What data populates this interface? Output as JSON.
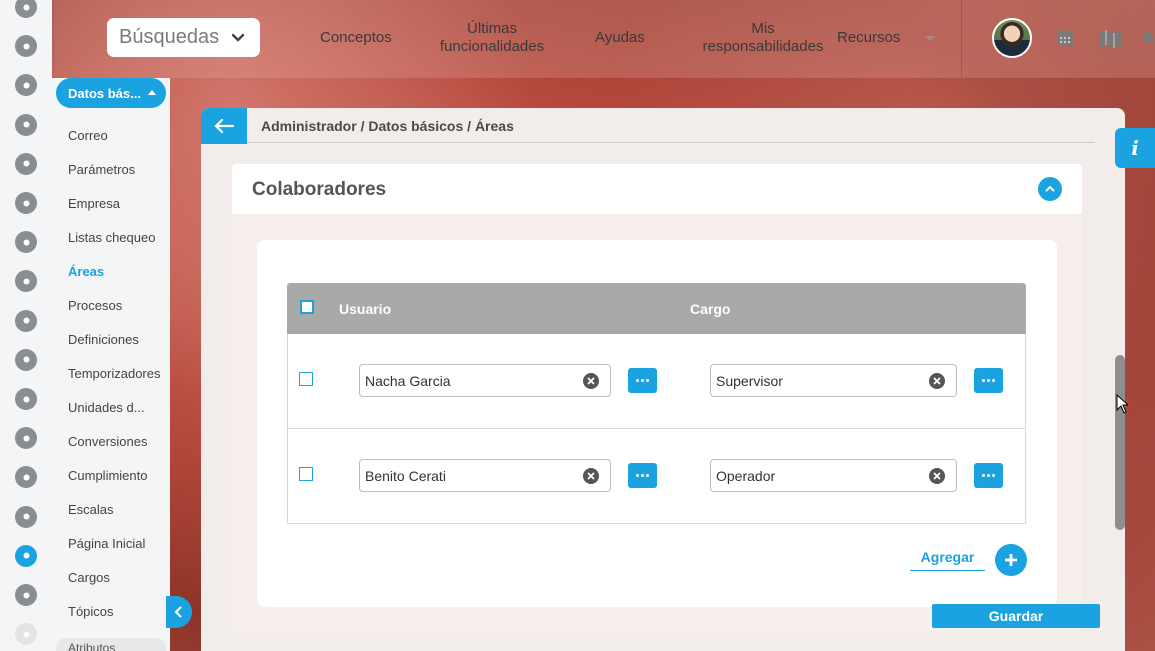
{
  "search": {
    "label": "Búsquedas"
  },
  "nav": {
    "items": [
      {
        "label": "Conceptos"
      },
      {
        "label": "Últimas funcionalidades"
      },
      {
        "label": "Ayudas"
      },
      {
        "label": "Mis responsabilidades"
      },
      {
        "label": "Recursos"
      }
    ]
  },
  "sidebar": {
    "section_label": "Datos bás...",
    "items": [
      {
        "label": "Correo"
      },
      {
        "label": "Parámetros"
      },
      {
        "label": "Empresa"
      },
      {
        "label": "Listas chequeo"
      },
      {
        "label": "Áreas"
      },
      {
        "label": "Procesos"
      },
      {
        "label": "Definiciones"
      },
      {
        "label": "Temporizadores"
      },
      {
        "label": "Unidades d..."
      },
      {
        "label": "Conversiones"
      },
      {
        "label": "Cumplimiento"
      },
      {
        "label": "Escalas"
      },
      {
        "label": "Página Inicial"
      },
      {
        "label": "Cargos"
      },
      {
        "label": "Tópicos"
      }
    ],
    "bottom_label": "Atributos",
    "active": "Áreas",
    "icons": [
      "chart-icon",
      "menu-icon",
      "pie-chart-icon",
      "document-icon",
      "cycle-icon",
      "check-icon",
      "warning-icon",
      "settings-group-icon",
      "monitor-icon",
      "clock-icon",
      "cloud-icon",
      "calendar-icon",
      "network-icon",
      "list-icon",
      "gear-icon",
      "alert-icon",
      "blank-icon"
    ]
  },
  "breadcrumb": "Administrador / Datos básicos / Áreas",
  "section": {
    "title": "Colaboradores"
  },
  "table": {
    "columns": [
      "Usuario",
      "Cargo"
    ],
    "rows": [
      {
        "usuario": "Nacha Garcia",
        "cargo": "Supervisor"
      },
      {
        "usuario": "Benito Cerati",
        "cargo": "Operador"
      }
    ]
  },
  "actions": {
    "add_label": "Agregar",
    "save_label": "Guardar"
  },
  "info_label": "i",
  "colors": {
    "accent": "#1aa3e0"
  }
}
